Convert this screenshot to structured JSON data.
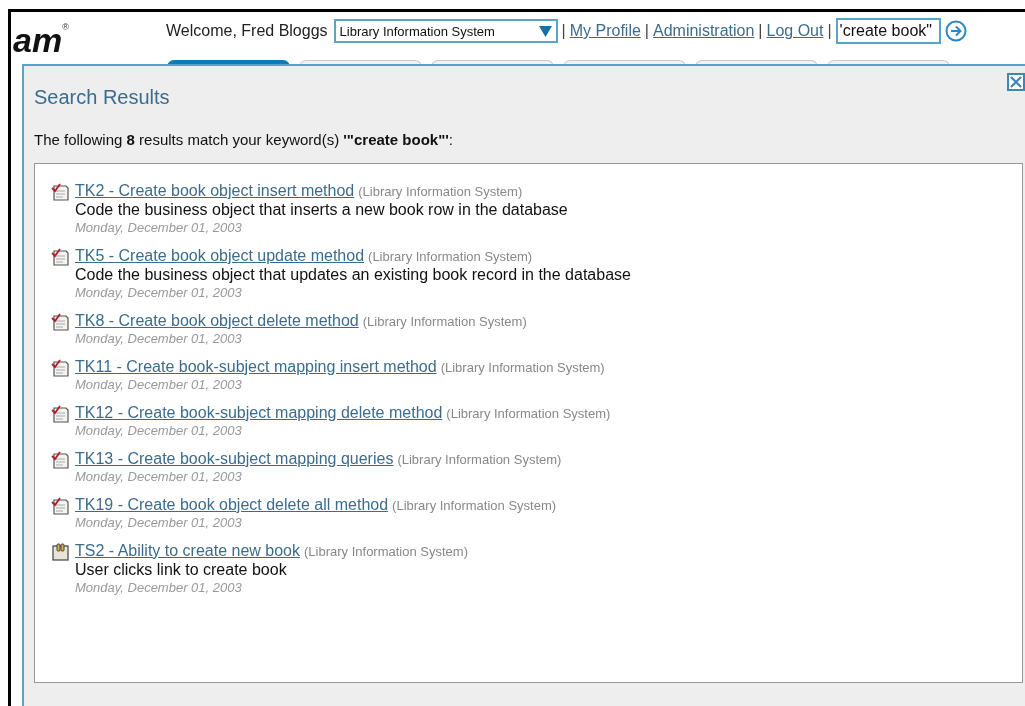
{
  "header": {
    "logo_text": "am",
    "logo_mark": "®",
    "welcome": "Welcome, Fred Bloggs",
    "project_select": {
      "value": "Library Information System"
    },
    "links": [
      "My Profile",
      "Administration",
      "Log Out"
    ],
    "separators": [
      "|",
      "|",
      "|",
      "|"
    ],
    "search": {
      "value": "'create book\""
    }
  },
  "tabs": [
    {
      "selected": true
    },
    {
      "selected": false
    },
    {
      "selected": false
    },
    {
      "selected": false
    },
    {
      "selected": false
    },
    {
      "selected": false
    }
  ],
  "dialog": {
    "title": "Search Results",
    "summary": "The following **8** results match your keyword(s) **'\"create book\"'**:",
    "results": [
      {
        "kind": "task",
        "title": "TK2 - Create book object insert method",
        "project": "(Library Information System)",
        "description": "Code the business object that inserts a new book row in the database",
        "date": "Monday, December 01, 2003"
      },
      {
        "kind": "task",
        "title": "TK5 - Create book object update method",
        "project": "(Library Information System)",
        "description": "Code the business object that updates an existing book record in the database",
        "date": "Monday, December 01, 2003"
      },
      {
        "kind": "task",
        "title": "TK8 - Create book object delete method",
        "project": "(Library Information System)",
        "date": "Monday, December 01, 2003"
      },
      {
        "kind": "task",
        "title": "TK11 - Create book-subject mapping insert method",
        "project": "(Library Information System)",
        "date": "Monday, December 01, 2003"
      },
      {
        "kind": "task",
        "title": "TK12 - Create book-subject mapping delete method",
        "project": "(Library Information System)",
        "date": "Monday, December 01, 2003"
      },
      {
        "kind": "task",
        "title": "TK13 - Create book-subject mapping queries",
        "project": "(Library Information System)",
        "date": "Monday, December 01, 2003"
      },
      {
        "kind": "task",
        "title": "TK19 - Create book object delete all method",
        "project": "(Library Information System)",
        "date": "Monday, December 01, 2003"
      },
      {
        "kind": "test",
        "title": "TS2 - Ability to create new book",
        "project": "(Library Information System)",
        "description": "User clicks link to create book",
        "date": "Monday, December 01, 2003"
      }
    ]
  }
}
